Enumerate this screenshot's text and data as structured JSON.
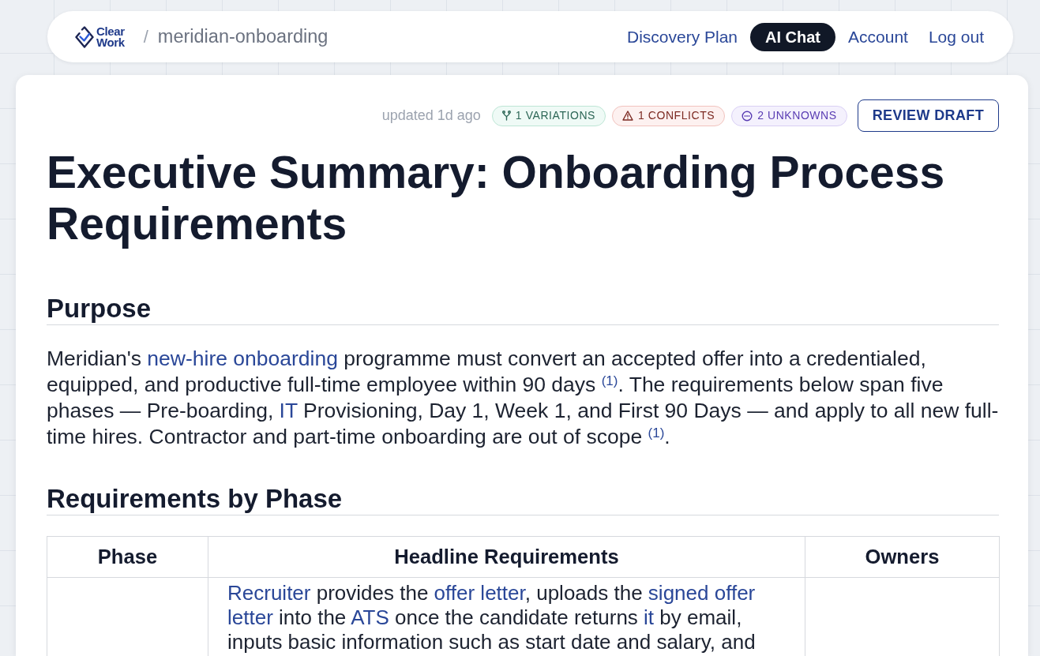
{
  "header": {
    "logo": "Clear Work",
    "separator": "/",
    "project": "meridian-onboarding",
    "nav": [
      {
        "label": "Discovery Plan",
        "selected": false
      },
      {
        "label": "AI Chat",
        "selected": true
      },
      {
        "label": "Account",
        "selected": false
      },
      {
        "label": "Log out",
        "selected": false
      }
    ]
  },
  "document": {
    "updated": "updated 1d ago",
    "badges": [
      {
        "kind": "variations",
        "label": "1 VARIATIONS"
      },
      {
        "kind": "conflicts",
        "label": "1 CONFLICTS"
      },
      {
        "kind": "unknowns",
        "label": "2 UNKNOWNS"
      }
    ],
    "action_button": "REVIEW DRAFT",
    "title": "Executive Summary: Onboarding Process Requirements",
    "sections": [
      {
        "heading": "Purpose",
        "paragraph": [
          {
            "kind": "text",
            "text": "Meridian's "
          },
          {
            "kind": "link",
            "text": "new-hire onboarding"
          },
          {
            "kind": "text",
            "text": " programme must convert an accepted offer into a credentialed, equipped, and productive full-time employee within 90 days "
          },
          {
            "kind": "citation",
            "text": "(1)"
          },
          {
            "kind": "text",
            "text": ". The requirements below span five phases — Pre-boarding, "
          },
          {
            "kind": "link",
            "text": "IT"
          },
          {
            "kind": "text",
            "text": " Provisioning, Day 1, Week 1, and First 90 Days — and apply to all new full-time hires. Contractor and part-time onboarding are out of scope "
          },
          {
            "kind": "citation",
            "text": "(1)"
          },
          {
            "kind": "text",
            "text": "."
          }
        ]
      },
      {
        "heading": "Requirements by Phase",
        "table": {
          "columns": [
            "Phase",
            "Headline Requirements",
            "Owners"
          ],
          "rows": [
            {
              "headline_requirements": [
                {
                  "kind": "link",
                  "text": "Recruiter"
                },
                {
                  "kind": "text",
                  "text": " provides the "
                },
                {
                  "kind": "link",
                  "text": "offer letter"
                },
                {
                  "kind": "text",
                  "text": ", uploads the "
                },
                {
                  "kind": "link",
                  "text": "signed offer "
                },
                {
                  "kind": "link",
                  "text": "letter"
                },
                {
                  "kind": "text",
                  "text": " into the "
                },
                {
                  "kind": "link",
                  "text": "ATS"
                },
                {
                  "kind": "text",
                  "text": " once the candidate returns "
                },
                {
                  "kind": "link",
                  "text": "it"
                },
                {
                  "kind": "text",
                  "text": " by email, inputs basic information such as start date and salary, and"
                }
              ]
            }
          ]
        }
      }
    ]
  }
}
